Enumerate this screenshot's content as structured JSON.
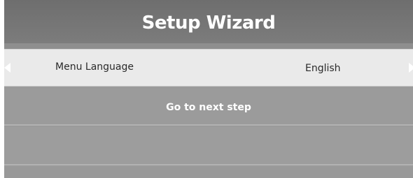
{
  "header": {
    "title": "Setup Wizard"
  },
  "menu": {
    "language_row": {
      "label": "Menu Language",
      "value": "English"
    },
    "next_step": {
      "label": "Go to next step"
    }
  },
  "icons": {
    "left": "triangle-left-icon",
    "right": "triangle-right-icon"
  },
  "colors": {
    "header_bg": "#747474",
    "selected_row_bg": "#eaeaea",
    "row_bg": "#9b9b9b",
    "title_text": "#ffffff",
    "selected_text": "#2a2a2a"
  }
}
